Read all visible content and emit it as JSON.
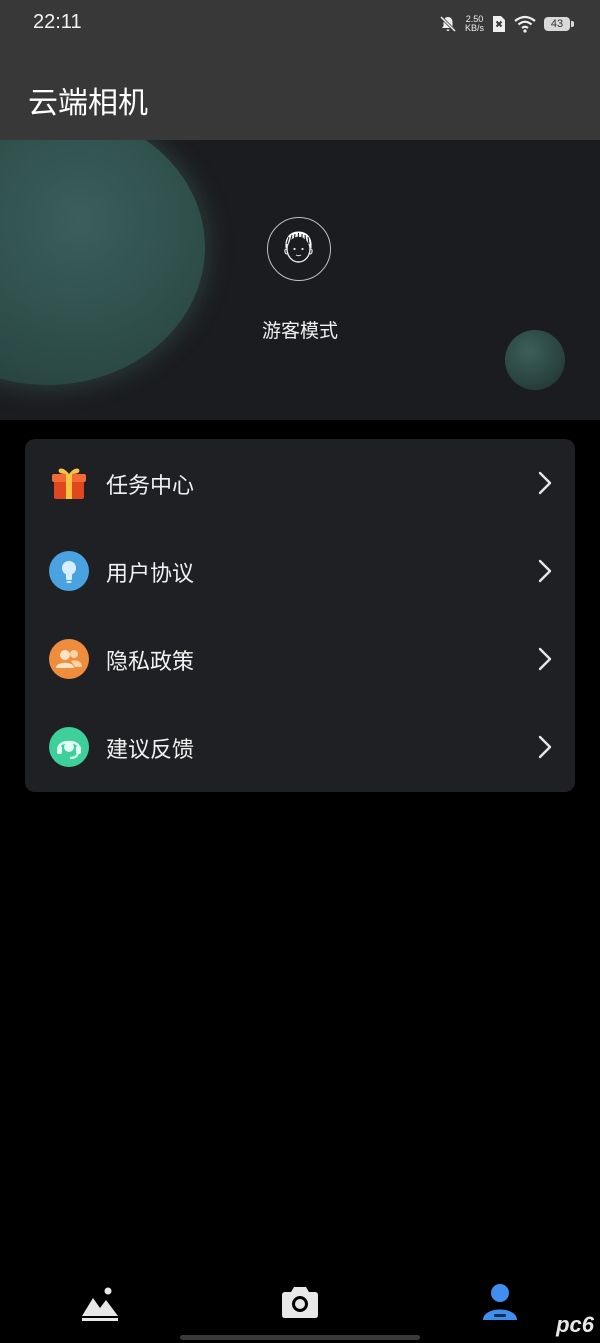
{
  "status_bar": {
    "time": "22:11",
    "net_speed_value": "2.50",
    "net_speed_unit": "KB/s",
    "battery": "43"
  },
  "header": {
    "title": "云端相机"
  },
  "profile": {
    "mode_label": "游客模式",
    "avatar_icon": "face-avatar-icon"
  },
  "menu": {
    "items": [
      {
        "label": "任务中心",
        "icon": "gift-icon",
        "color": "#e8542f"
      },
      {
        "label": "用户协议",
        "icon": "lightbulb-icon",
        "color": "#4aa3e0"
      },
      {
        "label": "隐私政策",
        "icon": "users-icon",
        "color": "#ee8d3d"
      },
      {
        "label": "建议反馈",
        "icon": "headset-icon",
        "color": "#3fcf9a"
      }
    ]
  },
  "bottom_nav": {
    "items": [
      {
        "icon": "gallery-icon",
        "active": false
      },
      {
        "icon": "camera-icon",
        "active": false
      },
      {
        "icon": "profile-icon",
        "active": true,
        "color": "#3f8ef0"
      }
    ]
  },
  "watermark": "pc6"
}
